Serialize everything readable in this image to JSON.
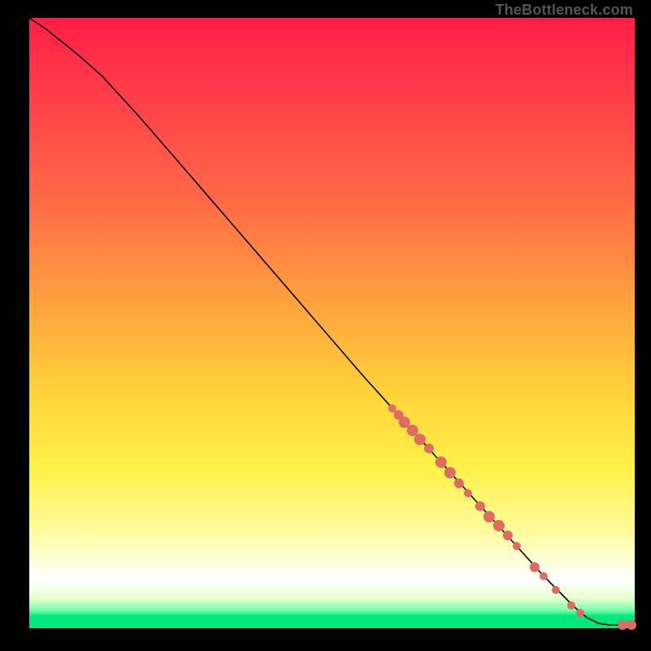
{
  "credit": "TheBottleneck.com",
  "colors": {
    "dot": "#e16b63",
    "curve": "#000000"
  },
  "chart_data": {
    "type": "line",
    "title": "",
    "xlabel": "",
    "ylabel": "",
    "xlim": [
      0,
      100
    ],
    "ylim": [
      0,
      100
    ],
    "grid": false,
    "curve": [
      {
        "x": 0,
        "y": 100
      },
      {
        "x": 3,
        "y": 98
      },
      {
        "x": 8,
        "y": 94
      },
      {
        "x": 12,
        "y": 90.5
      },
      {
        "x": 18,
        "y": 84
      },
      {
        "x": 25,
        "y": 76
      },
      {
        "x": 35,
        "y": 64.5
      },
      {
        "x": 45,
        "y": 53
      },
      {
        "x": 55,
        "y": 41.5
      },
      {
        "x": 60,
        "y": 36
      },
      {
        "x": 65,
        "y": 30.5
      },
      {
        "x": 70,
        "y": 25
      },
      {
        "x": 75,
        "y": 19.5
      },
      {
        "x": 80,
        "y": 14
      },
      {
        "x": 85,
        "y": 8.5
      },
      {
        "x": 90,
        "y": 3.5
      },
      {
        "x": 92,
        "y": 1.8
      },
      {
        "x": 94,
        "y": 0.8
      },
      {
        "x": 96,
        "y": 0.5
      },
      {
        "x": 99,
        "y": 0.5
      },
      {
        "x": 100,
        "y": 0.5
      }
    ],
    "points": [
      {
        "x": 60.0,
        "y": 36.0,
        "r": 5
      },
      {
        "x": 61.0,
        "y": 35.0,
        "r": 6
      },
      {
        "x": 62.0,
        "y": 33.8,
        "r": 7
      },
      {
        "x": 63.3,
        "y": 32.4,
        "r": 7
      },
      {
        "x": 64.5,
        "y": 31.0,
        "r": 7
      },
      {
        "x": 66.0,
        "y": 29.5,
        "r": 6
      },
      {
        "x": 68.0,
        "y": 27.2,
        "r": 7
      },
      {
        "x": 69.5,
        "y": 25.5,
        "r": 7
      },
      {
        "x": 71.0,
        "y": 23.8,
        "r": 6
      },
      {
        "x": 72.5,
        "y": 22.2,
        "r": 5
      },
      {
        "x": 74.5,
        "y": 20.0,
        "r": 6
      },
      {
        "x": 76.0,
        "y": 18.3,
        "r": 7
      },
      {
        "x": 77.5,
        "y": 16.8,
        "r": 7
      },
      {
        "x": 79.0,
        "y": 15.2,
        "r": 6
      },
      {
        "x": 80.5,
        "y": 13.5,
        "r": 5
      },
      {
        "x": 83.5,
        "y": 10.0,
        "r": 6
      },
      {
        "x": 85.0,
        "y": 8.5,
        "r": 5
      },
      {
        "x": 87.0,
        "y": 6.3,
        "r": 5
      },
      {
        "x": 89.5,
        "y": 3.8,
        "r": 5
      },
      {
        "x": 91.0,
        "y": 2.5,
        "r": 5
      },
      {
        "x": 98.0,
        "y": 0.5,
        "r": 6
      },
      {
        "x": 99.5,
        "y": 0.5,
        "r": 6
      }
    ]
  }
}
